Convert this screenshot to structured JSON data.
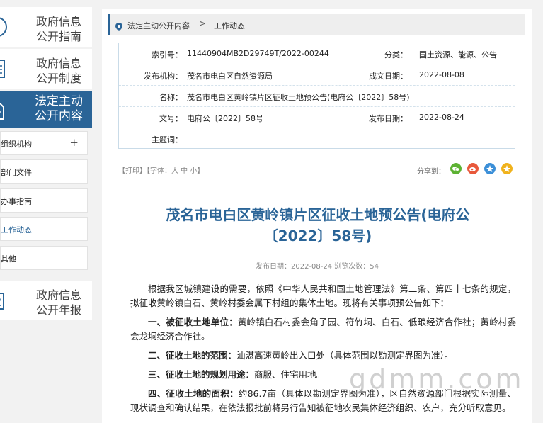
{
  "sidebar": {
    "top_items": [
      "政府信息公开指南",
      "政府信息公开制度",
      "法定主动公开内容",
      "政府信息公开年报"
    ],
    "top_lines": [
      [
        "政府信息",
        "公开指南"
      ],
      [
        "政府信息",
        "公开制度"
      ],
      [
        "法定主动",
        "公开内容"
      ],
      [
        "政府信息",
        "公开年报"
      ]
    ],
    "sub_items": [
      "组织机构",
      "部门文件",
      "办事指南",
      "工作动态",
      "其他"
    ],
    "sub_visible": [
      "组织机构",
      "部门文件",
      "办事指南",
      "工作动态",
      "其他"
    ],
    "expand_symbol": "+"
  },
  "breadcrumb": {
    "level1": "法定主动公开内容",
    "separator": ">",
    "level2": "工作动态"
  },
  "meta": {
    "index_label": "索引号：",
    "index_value": "11440904MB2D29749T/2022-00244",
    "category_label": "分类：",
    "category_value": "国土资源、能源、公告",
    "org_label": "发布机构：",
    "org_value": "茂名市电白区自然资源局",
    "date_label": "成文日期：",
    "date_value": "2022-08-08",
    "name_label": "名称：",
    "name_value": "茂名市电白区黄岭镇片区征收土地预公告(电府公〔2022〕58号)",
    "docno_label": "文号：",
    "docno_value": "电府公〔2022〕58号",
    "pubdate_label": "发布日期：",
    "pubdate_value": "2022-08-24",
    "topic_label": "主题词：",
    "topic_value": ""
  },
  "tools": {
    "text": "【打印】【字体：大  中  小】",
    "share_label": "分享到："
  },
  "share_colors": {
    "wechat": "#5db233",
    "weibo": "#e8583b",
    "qzone": "#3b8fd8",
    "favorite": "#f0b21c"
  },
  "article": {
    "title_line1": "茂名市电白区黄岭镇片区征收土地预公告(电府公",
    "title_line2": "〔2022〕58号)",
    "pub_info": "发布日期：2022-08-24  浏览次数：54",
    "p0": "根据我区城镇建设的需要，依照《中华人民共和国土地管理法》第二条、第四十七条的规定，拟征收黄岭镇白石、黄岭村委会属下村组的集体土地。现将有关事项预公告如下：",
    "p1_head": "一、被征收土地单位：",
    "p1_body": "黄岭镇白石村委会角子园、符竹垌、白石、低琅经济合作社；黄岭村委会龙垌经济合作社。",
    "p2_head": "二、征收土地的范围：",
    "p2_body": "汕湛高速黄岭出入口处（具体范围以勘测定界图为准）。",
    "p3_head": "三、征收土地的规划用途：",
    "p3_body": "商服、住宅用地。",
    "p4_head": "四、征收土地的面积：",
    "p4_body": "约86.7亩（具体以勘测定界图为准），区自然资源部门根据实际测量、现状调查和确认结果，在依法报批前将另行告知被征地农民集体经济组织、农户，充分听取意见。"
  },
  "watermark": "gdmm.com",
  "colors": {
    "accent": "#2a6497",
    "sidebar_active": "#2a6497"
  }
}
